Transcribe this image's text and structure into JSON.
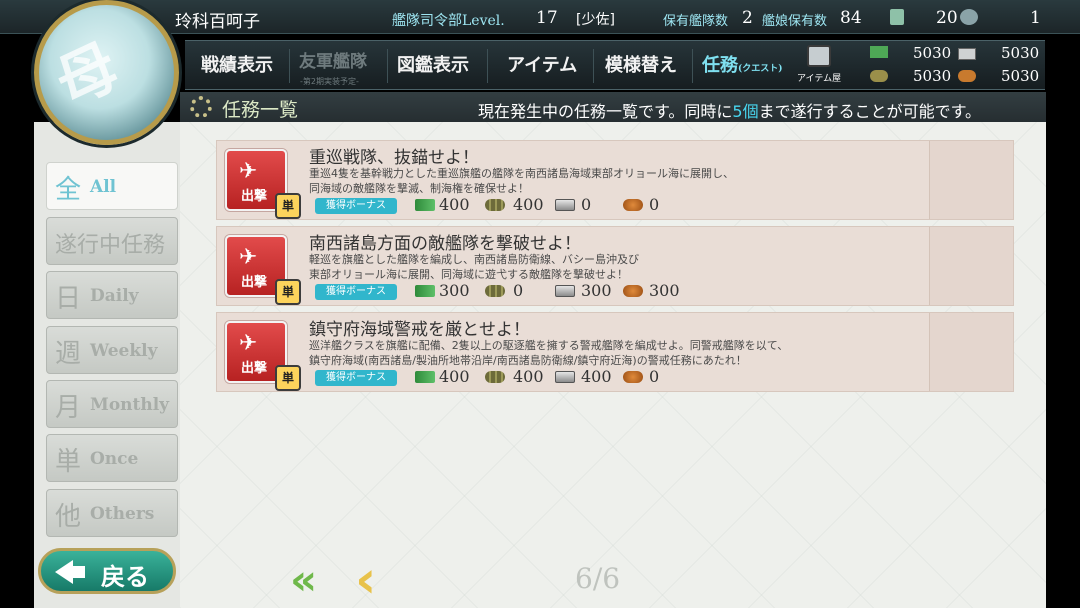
{
  "topbar": {
    "admiral_name": "玲科百呵子",
    "level_label": "艦隊司令部Level.",
    "level_value": "17",
    "rank": "[少佐]",
    "fleets_label": "保有艦隊数",
    "fleets_value": "2",
    "ships_label": "艦娘保有数",
    "ships_value": "84",
    "buckets_value": "20",
    "devmat_value": "1"
  },
  "nav": {
    "items": [
      {
        "label": "戦績表示",
        "enabled": true
      },
      {
        "label": "友軍艦隊",
        "enabled": false,
        "sub": "-第2期実装予定-"
      },
      {
        "label": "図鑑表示",
        "enabled": true
      },
      {
        "label": "アイテム",
        "enabled": true
      },
      {
        "label": "模様替え",
        "enabled": true
      },
      {
        "label": "任務",
        "enabled": true,
        "sub": "(クエスト)"
      }
    ],
    "shop_label": "アイテム屋"
  },
  "resources": {
    "fuel": "5030",
    "ammo": "5030",
    "steel": "5030",
    "bauxite": "5030"
  },
  "header": {
    "title": "任務一覧",
    "message_pre": "現在発生中の任務一覧です。同時に",
    "message_num": "5個",
    "message_post": "まで遂行することが可能です。"
  },
  "tabs": [
    {
      "kanji": "全",
      "label": "All",
      "active": true
    },
    {
      "kanji": "遂行中任務",
      "label": "",
      "active": false
    },
    {
      "kanji": "日",
      "label": "Daily",
      "active": false
    },
    {
      "kanji": "週",
      "label": "Weekly",
      "active": false
    },
    {
      "kanji": "月",
      "label": "Monthly",
      "active": false
    },
    {
      "kanji": "単",
      "label": "Once",
      "active": false
    },
    {
      "kanji": "他",
      "label": "Others",
      "active": false
    }
  ],
  "quests": [
    {
      "category": "出撃",
      "type_badge": "単",
      "title": "重巡戦隊、抜錨せよ！",
      "desc_line1": "重巡4隻を基幹戦力とした重巡旗艦の艦隊を南西諸島海域東部オリョール海に展開し、",
      "desc_line2": "同海域の敵艦隊を撃滅、制海権を確保せよ！",
      "bonus_label": "獲得ボーナス",
      "fuel": "400",
      "ammo": "400",
      "steel": "0",
      "bauxite": "0"
    },
    {
      "category": "出撃",
      "type_badge": "単",
      "title": "南西諸島方面の敵艦隊を撃破せよ！",
      "desc_line1": "軽巡を旗艦とした艦隊を編成し、南西諸島防衛線、バシー島沖及び",
      "desc_line2": "東部オリョール海に展開、同海域に遊弋する敵艦隊を撃破せよ！",
      "bonus_label": "獲得ボーナス",
      "fuel": "300",
      "ammo": "0",
      "steel": "300",
      "bauxite": "300"
    },
    {
      "category": "出撃",
      "type_badge": "単",
      "title": "鎮守府海域警戒を厳とせよ！",
      "desc_line1": "巡洋艦クラスを旗艦に配備、2隻以上の駆逐艦を擁する警戒艦隊を編成せよ。同警戒艦隊を以て、",
      "desc_line2": "鎮守府海域(南西諸島/製油所地帯沿岸/南西諸島防衛線/鎮守府近海)の警戒任務にあたれ！",
      "bonus_label": "獲得ボーナス",
      "fuel": "400",
      "ammo": "400",
      "steel": "400",
      "bauxite": "0"
    }
  ],
  "back_button": "戻る",
  "pager": {
    "page": "6/6"
  }
}
